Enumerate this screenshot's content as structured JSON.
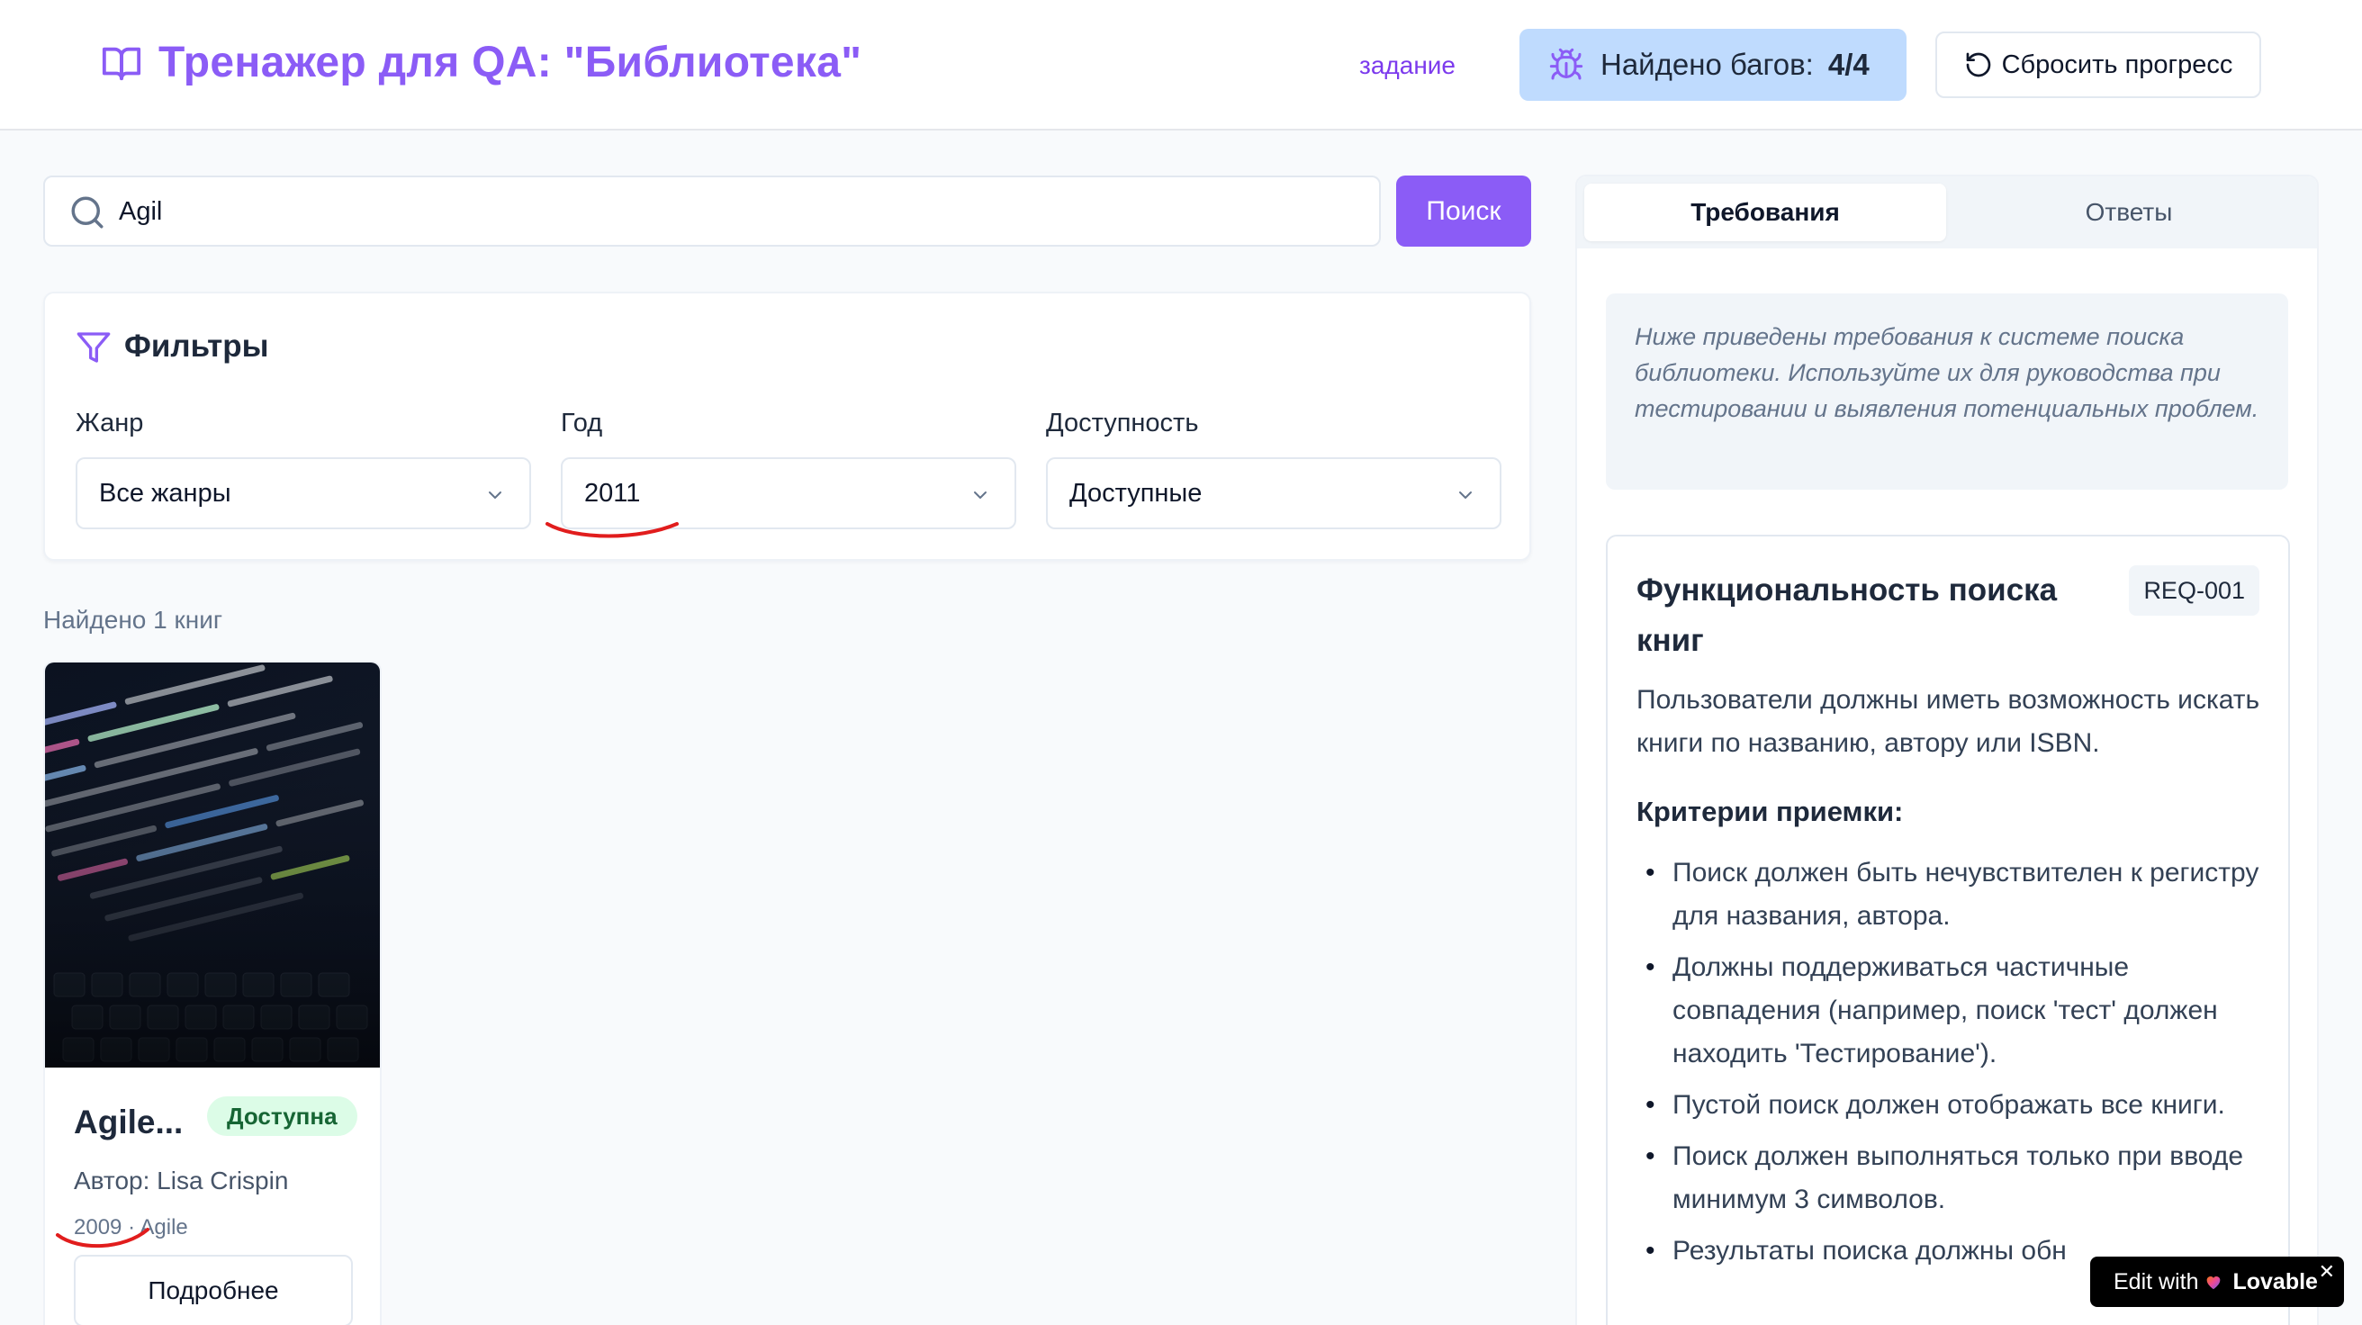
{
  "header": {
    "title": "Тренажер для QA: \"Библиотека\"",
    "task_link": "задание",
    "bugs_label": "Найдено багов:",
    "bugs_count": "4/4",
    "reset_label": "Сбросить прогресс"
  },
  "search": {
    "value": "Agil",
    "button_label": "Поиск"
  },
  "filters": {
    "title": "Фильтры",
    "genre": {
      "label": "Жанр",
      "value": "Все жанры"
    },
    "year": {
      "label": "Год",
      "value": "2011"
    },
    "availability": {
      "label": "Доступность",
      "value": "Доступные"
    }
  },
  "results": {
    "count_text": "Найдено 1 книг",
    "books": [
      {
        "title": "Agile...",
        "status": "Доступна",
        "author": "Автор: Lisa Crispin",
        "year": "2009",
        "genre": "Agile",
        "details_label": "Подробнее"
      }
    ]
  },
  "right_panel": {
    "tabs": [
      "Требования",
      "Ответы"
    ],
    "active_tab": "Требования",
    "intro": "Ниже приведены требования к системе поиска библиотеки. Используйте их для руководства при тестировании и выявления потенциальных проблем.",
    "requirement": {
      "title": "Функциональность поиска книг",
      "id": "REQ-001",
      "description": "Пользователи должны иметь возможность искать книги по названию, автору или ISBN.",
      "criteria_heading": "Критерии приемки:",
      "criteria": [
        "Поиск должен быть нечувствителен к регистру для названия, автора.",
        "Должны поддерживаться частичные совпадения (например, поиск 'тест' должен находить 'Тестирование').",
        "Пустой поиск должен отображать все книги.",
        "Поиск должен выполняться только при вводе минимум 3 символов.",
        "Результаты поиска должны обн"
      ]
    }
  },
  "lovable_badge": {
    "prefix": "Edit with",
    "brand": "Lovable",
    "close": "✕"
  },
  "colors": {
    "accent": "#8b5cf6",
    "bugs_bg": "#bfdbfe",
    "available_bg": "#dcfce7",
    "annotation": "#e11d1d"
  }
}
